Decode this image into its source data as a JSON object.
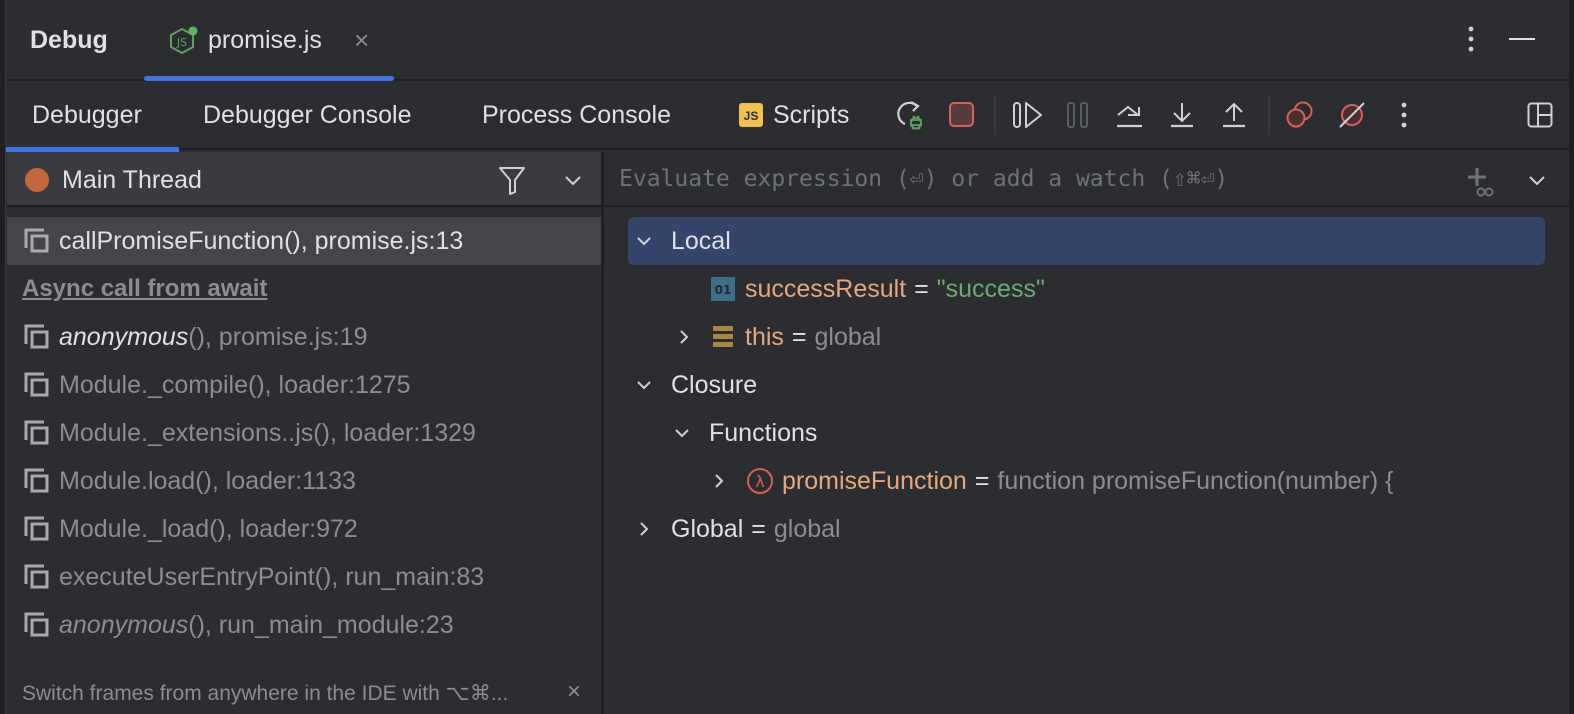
{
  "window": {
    "title": "Debug",
    "file_tab": {
      "label": "promise.js",
      "icon": "nodejs-icon"
    }
  },
  "tabs": [
    {
      "label": "Debugger",
      "active": true
    },
    {
      "label": "Debugger Console",
      "active": false
    },
    {
      "label": "Process Console",
      "active": false
    },
    {
      "label": "Scripts",
      "active": false,
      "badge": "JS"
    }
  ],
  "toolbar": {
    "buttons": [
      {
        "name": "rerun-debug",
        "icon": "rerun-debug-icon"
      },
      {
        "name": "stop",
        "icon": "stop-icon"
      },
      {
        "name": "resume",
        "icon": "resume-icon"
      },
      {
        "name": "pause",
        "icon": "pause-icon",
        "disabled": true
      },
      {
        "name": "step-over",
        "icon": "step-over-icon"
      },
      {
        "name": "step-into",
        "icon": "step-into-icon"
      },
      {
        "name": "step-out",
        "icon": "step-out-icon"
      },
      {
        "name": "view-breakpoints",
        "icon": "view-breakpoints-icon"
      },
      {
        "name": "mute-breakpoints",
        "icon": "mute-breakpoints-icon"
      },
      {
        "name": "more",
        "icon": "more-vertical-icon"
      },
      {
        "name": "layout",
        "icon": "layout-icon"
      }
    ]
  },
  "thread": {
    "name": "Main Thread",
    "status_color": "#c5663a"
  },
  "frames": [
    {
      "fn": "callPromiseFunction()",
      "loc": ", promise.js:13",
      "italic": false,
      "selected": true
    },
    {
      "async_label": "Async call from await"
    },
    {
      "fn": "anonymous",
      "suffix": "()",
      "loc": ", promise.js:19",
      "italic": true,
      "bright": true
    },
    {
      "fn": "Module._compile()",
      "loc": ", loader:1275",
      "italic": false
    },
    {
      "fn": "Module._extensions..js()",
      "loc": ", loader:1329",
      "italic": false
    },
    {
      "fn": "Module.load()",
      "loc": ", loader:1133",
      "italic": false
    },
    {
      "fn": "Module._load()",
      "loc": ", loader:972",
      "italic": false
    },
    {
      "fn": "executeUserEntryPoint()",
      "loc": ", run_main:83",
      "italic": false
    },
    {
      "fn": "anonymous",
      "suffix": "()",
      "loc": ", run_main_module:23",
      "italic": true
    }
  ],
  "hint": {
    "text": "Switch frames from anywhere in the IDE with ⌥⌘...",
    "close": "×"
  },
  "evaluate": {
    "placeholder": "Evaluate expression (⏎) or add a watch (⇧⌘⏎)",
    "value": ""
  },
  "variables": {
    "local": {
      "label": "Local"
    },
    "successResult": {
      "name": "successResult",
      "eq": "=",
      "value": "\"success\"",
      "icon": "primitive-icon",
      "icon_text": "01"
    },
    "this": {
      "name": "this",
      "eq": "=",
      "value": "global",
      "icon": "object-icon"
    },
    "closure": {
      "label": "Closure"
    },
    "functions": {
      "label": "Functions"
    },
    "promiseFunction": {
      "name": "promiseFunction",
      "eq": "=",
      "value": "function promiseFunction(number) {",
      "icon": "lambda-icon"
    },
    "global": {
      "label": "Global",
      "eq": "=",
      "value": "global"
    }
  },
  "colors": {
    "accent": "#3f73e3",
    "selection": "#35446b",
    "varname": "#e8a77d",
    "string": "#6aab73",
    "stop": "#d9605a"
  }
}
